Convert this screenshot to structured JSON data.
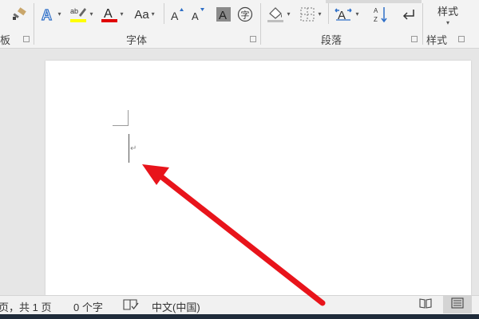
{
  "ribbon": {
    "groups": {
      "clipboard_label": "板",
      "font_label": "字体",
      "paragraph_label": "段落",
      "styles_label": "样式"
    },
    "font_size_label": "Aa",
    "styles_button_label": "样式",
    "icons": [
      "format-painter-icon",
      "text-effects-icon",
      "highlight-icon",
      "font-color-icon",
      "change-case-icon",
      "grow-font-icon",
      "shrink-font-icon",
      "char-shading-icon",
      "enclose-char-icon",
      "shading-icon",
      "borders-icon",
      "chinese-layout-icon",
      "sort-icon",
      "show-marks-icon"
    ],
    "colors": {
      "highlight": "#ffff00",
      "font_color": "#e00000",
      "accent": "#2b579a"
    }
  },
  "document": {
    "paragraph_mark": "↵"
  },
  "statusbar": {
    "page_info": "页，共 1 页",
    "word_count": "0 个字",
    "language": "中文(中国)"
  },
  "annotation": {
    "arrow_color": "#e8141b"
  }
}
